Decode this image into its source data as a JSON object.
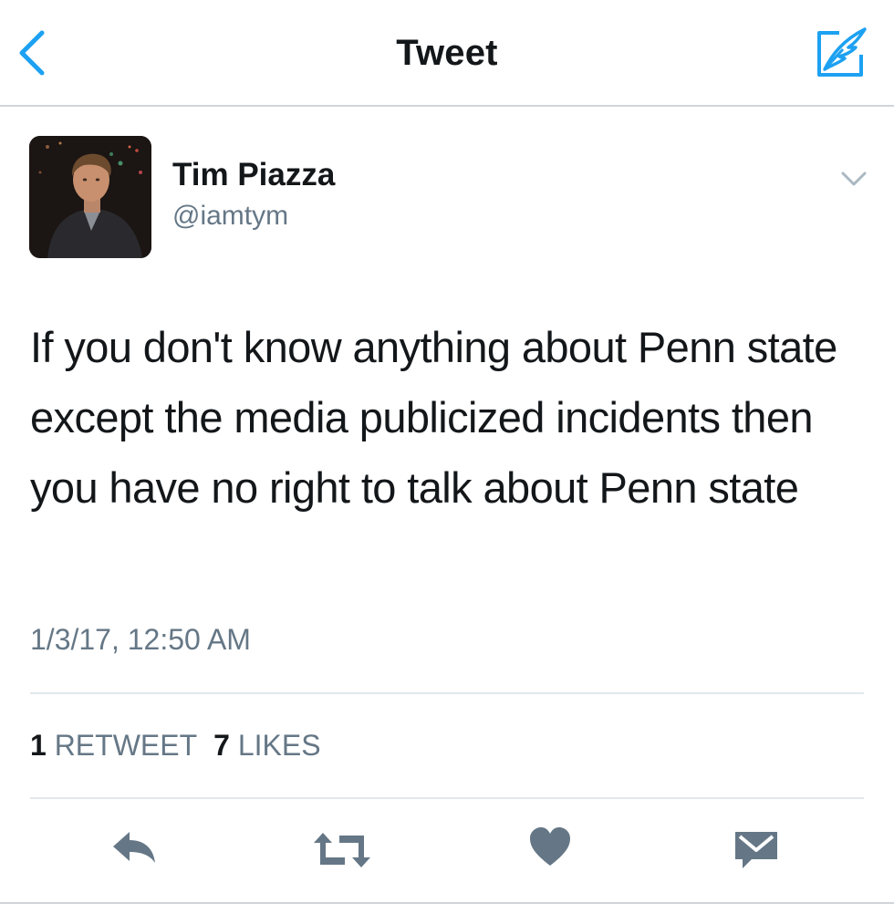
{
  "nav": {
    "title": "Tweet"
  },
  "tweet": {
    "user_name": "Tim Piazza",
    "user_handle": "@iamtym",
    "text": "If you don't know anything about Penn state except the media publicized incidents then you have no right to talk about Penn state",
    "timestamp": "1/3/17, 12:50 AM",
    "retweet_count": "1",
    "retweet_label": "RETWEET",
    "like_count": "7",
    "like_label": "LIKES"
  },
  "icons": {
    "back": "chevron-left-icon",
    "compose": "compose-tweet-icon",
    "caret": "chevron-down-icon",
    "reply": "reply-icon",
    "retweet": "retweet-icon",
    "like": "heart-icon",
    "message": "envelope-icon"
  },
  "colors": {
    "accent": "#1da1f2",
    "text": "#14171a",
    "secondary": "#657786",
    "action_icons": "#657786",
    "divider": "#e1e8ed"
  }
}
